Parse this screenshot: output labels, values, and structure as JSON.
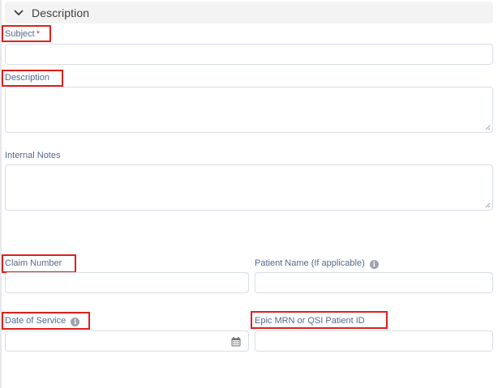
{
  "section": {
    "title": "Description",
    "chevron_icon": "chevron-down-icon"
  },
  "fields": {
    "subject": {
      "label": "Subject",
      "required_marker": "*",
      "value": ""
    },
    "description": {
      "label": "Description",
      "value": ""
    },
    "internal_notes": {
      "label": "Internal Notes",
      "value": ""
    },
    "claim_number": {
      "label": "Claim Number",
      "value": ""
    },
    "patient_name": {
      "label": "Patient Name (If applicable)",
      "info_icon": "info-icon",
      "value": ""
    },
    "date_of_service": {
      "label": "Date of Service",
      "info_icon": "info-icon",
      "calendar_icon": "calendar-icon",
      "value": ""
    },
    "epic_mrn": {
      "label": "Epic MRN or QSI Patient ID",
      "value": ""
    }
  },
  "colors": {
    "label": "#54698d",
    "border": "#d8dde6",
    "highlight": "#e0201b",
    "header_bg": "#f3f3f3"
  }
}
